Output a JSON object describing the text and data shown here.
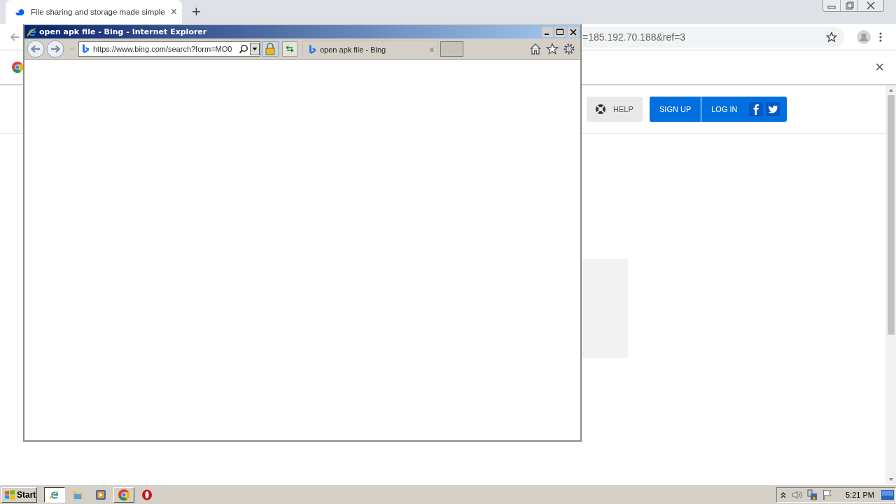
{
  "browser": {
    "tab": {
      "title": "File sharing and storage made simple",
      "close": "×"
    },
    "new_tab": "+",
    "address_tail": "=185.192.70.188&ref=3",
    "infobar_close": "×"
  },
  "page": {
    "help": "HELP",
    "sign_up": "SIGN UP",
    "log_in": "LOG IN"
  },
  "ie_window": {
    "title": "open apk file - Bing - Internet Explorer",
    "address": "https://www.bing.com/search?form=MO0",
    "tab": {
      "title": "open apk file - Bing",
      "close": "×"
    }
  },
  "taskbar": {
    "start": "Start",
    "apps": [
      {
        "kind": "ie",
        "selected": true,
        "open": true
      },
      {
        "kind": "folder",
        "selected": false,
        "open": false
      },
      {
        "kind": "media",
        "selected": false,
        "open": false
      },
      {
        "kind": "chrome",
        "selected": false,
        "open": true
      },
      {
        "kind": "opera",
        "selected": false,
        "open": false
      }
    ],
    "clock": "5:21 PM"
  }
}
